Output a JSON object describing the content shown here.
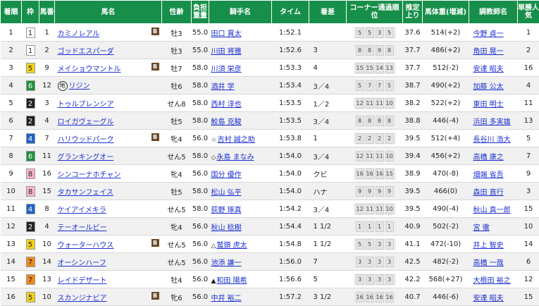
{
  "colors": {
    "header_bg": "#178f4a",
    "link": "#1a2fd0",
    "frames": {
      "1": [
        "#ffffff",
        "#222222"
      ],
      "2": [
        "#222222",
        "#ffffff"
      ],
      "3": [
        "#e0252a",
        "#ffffff"
      ],
      "4": [
        "#1d63c7",
        "#ffffff"
      ],
      "5": [
        "#f2d31a",
        "#222222"
      ],
      "6": [
        "#1d8f3a",
        "#ffffff"
      ],
      "7": [
        "#f08a1c",
        "#222222"
      ],
      "8": [
        "#f7b4c8",
        "#222222"
      ]
    }
  },
  "headers": [
    "着順",
    "枠",
    "馬番",
    "馬名",
    "性齢",
    "負担重量",
    "騎手名",
    "タイム",
    "着差",
    "コーナー通過順位",
    "推定上り",
    "馬体重(増減)",
    "調教師名",
    "単勝人気"
  ],
  "blinker_label": "B",
  "rows": [
    {
      "rank": "1",
      "frame": "1",
      "num": "1",
      "horse": "カミノレアル",
      "blinker": true,
      "sexage": "牡3",
      "weight": "55.0",
      "jockey_mark": "",
      "jockey": "田口 貫太",
      "time": "1:52.1",
      "margin": "",
      "corners": [
        "5",
        "5",
        "3",
        "5"
      ],
      "last3f": "37.6",
      "bodyweight": "514(+2)",
      "trainer": "今野 貞一",
      "pop": "1"
    },
    {
      "rank": "2",
      "frame": "1",
      "num": "2",
      "horse": "ゴッドエスパーダ",
      "blinker": false,
      "sexage": "牡3",
      "weight": "55.0",
      "jockey_mark": "",
      "jockey": "川田 将雅",
      "time": "1:52.6",
      "margin": "3",
      "corners": [
        "8",
        "8",
        "9",
        "8"
      ],
      "last3f": "37.7",
      "bodyweight": "486(+2)",
      "trainer": "角田 晃一",
      "pop": "2"
    },
    {
      "rank": "3",
      "frame": "5",
      "num": "9",
      "horse": "メイショウマントル",
      "blinker": true,
      "sexage": "牡7",
      "weight": "58.0",
      "jockey_mark": "",
      "jockey": "川須 栄彦",
      "time": "1:53.3",
      "margin": "4",
      "corners": [
        "15",
        "15",
        "14",
        "13"
      ],
      "last3f": "37.7",
      "bodyweight": "512(-2)",
      "trainer": "安達 昭夫",
      "pop": "16"
    },
    {
      "rank": "4",
      "frame": "6",
      "num": "12",
      "horse": "リジン",
      "blinker": false,
      "marker": "地",
      "sexage": "牡6",
      "weight": "58.0",
      "jockey_mark": "",
      "jockey": "酒井 学",
      "time": "1:53.4",
      "margin": "3／4",
      "corners": [
        "5",
        "7",
        "7",
        "5"
      ],
      "last3f": "38.7",
      "bodyweight": "490(+2)",
      "trainer": "加藤 公太",
      "pop": "4"
    },
    {
      "rank": "5",
      "frame": "2",
      "num": "3",
      "horse": "トゥルブレンシア",
      "blinker": false,
      "sexage": "せん8",
      "weight": "58.0",
      "jockey_mark": "",
      "jockey": "西村 淳也",
      "time": "1:53.5",
      "margin": "1／2",
      "corners": [
        "12",
        "11",
        "11",
        "10"
      ],
      "last3f": "38.2",
      "bodyweight": "522(+2)",
      "trainer": "東田 明士",
      "pop": "11"
    },
    {
      "rank": "6",
      "frame": "2",
      "num": "4",
      "horse": "ロイガヴェーグル",
      "blinker": false,
      "sexage": "牡5",
      "weight": "58.0",
      "jockey_mark": "",
      "jockey": "鮫島 克駿",
      "time": "1:53.5",
      "margin": "3／4",
      "corners": [
        "8",
        "8",
        "8",
        "8"
      ],
      "last3f": "38.8",
      "bodyweight": "446(-4)",
      "trainer": "浜田 多実雄",
      "pop": "13"
    },
    {
      "rank": "7",
      "frame": "4",
      "num": "7",
      "horse": "ハリウッドパーク",
      "blinker": true,
      "sexage": "牝4",
      "weight": "56.0",
      "jockey_mark": "☆",
      "jockey": "吉村 誠之助",
      "time": "1:53.8",
      "margin": "1",
      "corners": [
        "2",
        "2",
        "2",
        "2"
      ],
      "last3f": "39.5",
      "bodyweight": "512(+4)",
      "trainer": "長谷川 浩大",
      "pop": "5"
    },
    {
      "rank": "8",
      "frame": "6",
      "num": "11",
      "horse": "グランキングオー",
      "blinker": false,
      "sexage": "せん5",
      "weight": "58.0",
      "jockey_mark": "◇",
      "jockey": "永島 まなみ",
      "time": "1:54.0",
      "margin": "3／4",
      "corners": [
        "12",
        "11",
        "11",
        "10"
      ],
      "last3f": "39.4",
      "bodyweight": "456(+2)",
      "trainer": "高橋 康之",
      "pop": "7"
    },
    {
      "rank": "9",
      "frame": "8",
      "num": "16",
      "horse": "シンコーナホチャン",
      "blinker": false,
      "sexage": "牝4",
      "weight": "56.0",
      "jockey_mark": "",
      "jockey": "国分 優作",
      "time": "1:54.0",
      "margin": "クビ",
      "corners": [
        "16",
        "16",
        "16",
        "15"
      ],
      "last3f": "38.9",
      "bodyweight": "470(-8)",
      "trainer": "畑端 省吾",
      "pop": "9"
    },
    {
      "rank": "10",
      "frame": "8",
      "num": "15",
      "horse": "タカサンフェイス",
      "blinker": false,
      "sexage": "牡5",
      "weight": "58.0",
      "jockey_mark": "",
      "jockey": "松山 弘平",
      "time": "1:54.0",
      "margin": "ハナ",
      "corners": [
        "9",
        "9",
        "9",
        "9"
      ],
      "last3f": "39.5",
      "bodyweight": "466(0)",
      "trainer": "森田 直行",
      "pop": "3"
    },
    {
      "rank": "11",
      "frame": "4",
      "num": "8",
      "horse": "ケイアイメキラ",
      "blinker": false,
      "sexage": "せん5",
      "weight": "58.0",
      "jockey_mark": "",
      "jockey": "荻野 琢真",
      "time": "1:54.2",
      "margin": "3／4",
      "corners": [
        "12",
        "11",
        "11",
        "10"
      ],
      "last3f": "39.5",
      "bodyweight": "490(-4)",
      "trainer": "秋山 真一郎",
      "pop": "15"
    },
    {
      "rank": "12",
      "frame": "2",
      "num": "4",
      "horse": "テーオールビー",
      "blinker": false,
      "sexage": "牝4",
      "weight": "56.0",
      "jockey_mark": "",
      "jockey": "秋山 稔樹",
      "time": "1:54.4",
      "margin": "1 1/2",
      "corners": [
        "1",
        "1",
        "1",
        "1"
      ],
      "last3f": "40.9",
      "bodyweight": "502(-2)",
      "trainer": "宮 徹",
      "pop": "10"
    },
    {
      "rank": "13",
      "frame": "5",
      "num": "10",
      "horse": "ウォーターハウス",
      "blinker": true,
      "sexage": "せん5",
      "weight": "56.0",
      "jockey_mark": "△",
      "jockey": "鷲頭 虎太",
      "time": "1:54.8",
      "margin": "1 1/2",
      "corners": [
        "5",
        "5",
        "3",
        "3"
      ],
      "last3f": "41.1",
      "bodyweight": "472(-10)",
      "trainer": "井上 智史",
      "pop": "14"
    },
    {
      "rank": "14",
      "frame": "7",
      "num": "14",
      "horse": "オーシンハーフ",
      "blinker": false,
      "sexage": "せん5",
      "weight": "56.0",
      "jockey_mark": "",
      "jockey": "池添 謙一",
      "time": "1:56.0",
      "margin": "7",
      "corners": [
        "3",
        "3",
        "3",
        "3"
      ],
      "last3f": "42.5",
      "bodyweight": "482(-2)",
      "trainer": "高橋 一哉",
      "pop": "6"
    },
    {
      "rank": "15",
      "frame": "7",
      "num": "13",
      "horse": "レイドデザート",
      "blinker": false,
      "sexage": "牡4",
      "weight": "56.0",
      "jockey_mark": "▲",
      "jockey": "和田 陽希",
      "time": "1:56.6",
      "margin": "5",
      "corners": [
        "3",
        "3",
        "3",
        "3"
      ],
      "last3f": "42.2",
      "bodyweight": "568(+27)",
      "trainer": "大根田 裕之",
      "pop": "12"
    },
    {
      "rank": "16",
      "frame": "5",
      "num": "10",
      "horse": "スカンジナビア",
      "blinker": true,
      "sexage": "牝6",
      "weight": "56.0",
      "jockey_mark": "",
      "jockey": "中井 裕二",
      "time": "1:57.2",
      "margin": "3 1/2",
      "corners": [
        "16",
        "16",
        "16",
        "16"
      ],
      "last3f": "40.7",
      "bodyweight": "446(-6)",
      "trainer": "安達 昭夫",
      "pop": "15"
    }
  ]
}
